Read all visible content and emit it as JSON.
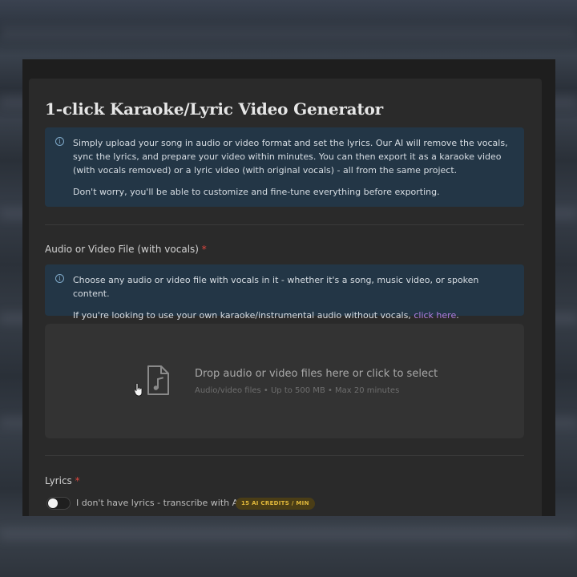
{
  "page": {
    "title": "1-click Karaoke/Lyric Video Generator"
  },
  "intro": {
    "icon": "info-icon",
    "paragraph1": "Simply upload your song in audio or video format and set the lyrics. Our AI will remove the vocals, sync the lyrics, and prepare your video within minutes. You can then export it as a karaoke video (with vocals removed) or a lyric video (with original vocals) - all from the same project.",
    "paragraph2": "Don't worry, you'll be able to customize and fine-tune everything before exporting."
  },
  "file_section": {
    "label": "Audio or Video File (with vocals)",
    "required_mark": "*",
    "info_icon": "info-icon",
    "info_line1": "Choose any audio or video file with vocals in it - whether it's a song, music video, or spoken content.",
    "info_line2_prefix": "If you're looking to use your own karaoke/instrumental audio without vocals, ",
    "info_link": "click here",
    "info_line2_suffix": ".",
    "dropzone": {
      "icon": "music-file-icon",
      "title": "Drop audio or video files here or click to select",
      "subtitle": "Audio/video files • Up to 500 MB • Max 20 minutes"
    }
  },
  "lyrics_section": {
    "label": "Lyrics",
    "required_mark": "*",
    "toggle_label": "I don't have lyrics - transcribe with AI",
    "toggle_on": false,
    "badge": "15 AI CREDITS / MIN"
  },
  "colors": {
    "accent_link": "#b07de0",
    "required": "#e0473f",
    "info_bg": "#233646",
    "badge_text": "#e2b93b"
  }
}
